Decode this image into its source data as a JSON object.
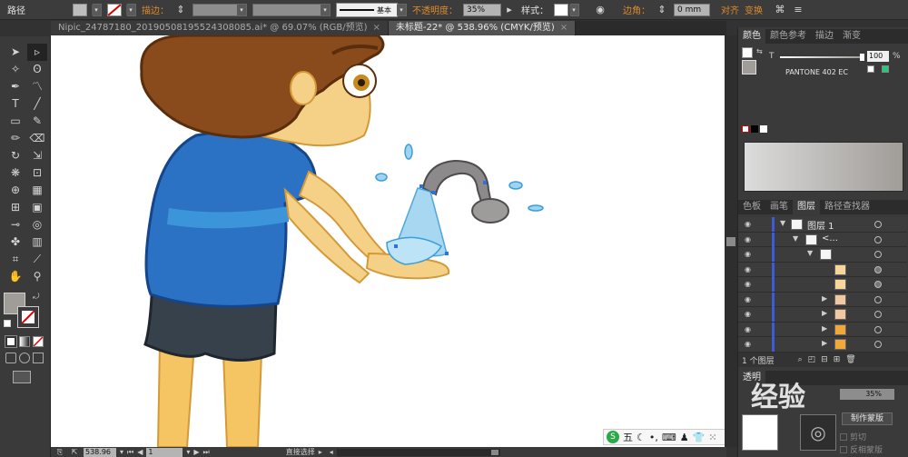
{
  "control_bar": {
    "mode_label": "路径",
    "stroke_label": "描边：",
    "brush_style": "基本",
    "opacity_label": "不透明度：",
    "opacity_value": "35%",
    "style_label": "样式：",
    "corner_label": "边角：",
    "corner_value": "0 mm",
    "align_label": "对齐",
    "transform_label": "变换"
  },
  "tabs": [
    {
      "label": "Nipic_24787180_20190508195524308085.ai* @ 69.07% (RGB/预览)",
      "close": "×"
    },
    {
      "label": "未标题-22* @ 538.96% (CMYK/预览)",
      "close": "×"
    }
  ],
  "color_panel": {
    "tabs": [
      "颜色",
      "颜色参考",
      "描边",
      "渐变"
    ],
    "tint_label": "T",
    "tint_value": "100",
    "percent": "%",
    "swatch_name": "PANTONE 402 EC",
    "gradient_from": "#dcdcdc",
    "gradient_to": "#a09c98"
  },
  "layers_panel": {
    "tabs": [
      "色板",
      "画笔",
      "图层",
      "路径查找器"
    ],
    "rows": [
      {
        "name": "图层 1",
        "level": 0,
        "expanded": true
      },
      {
        "name": "<...",
        "level": 1,
        "expanded": true
      },
      {
        "name": "",
        "level": 2,
        "expanded": true
      },
      {
        "name": "",
        "level": 3,
        "expanded": false
      },
      {
        "name": "",
        "level": 3,
        "expanded": false
      },
      {
        "name": "",
        "level": 3,
        "expanded": true
      },
      {
        "name": "",
        "level": 3,
        "expanded": true
      },
      {
        "name": "",
        "level": 3,
        "expanded": true
      }
    ],
    "footer_count": "1 个图层"
  },
  "transparency_panel": {
    "tab": "透明",
    "opacity_value": "35%",
    "make_mask_button": "制作蒙版",
    "clip_label": "剪切",
    "invert_mask_label": "反相蒙版"
  },
  "status_bar": {
    "zoom": "538.96",
    "page": "1",
    "tool_name": "直接选择"
  },
  "ime_bar": {
    "logo": "S",
    "mode": "五"
  },
  "watermark": "经验"
}
